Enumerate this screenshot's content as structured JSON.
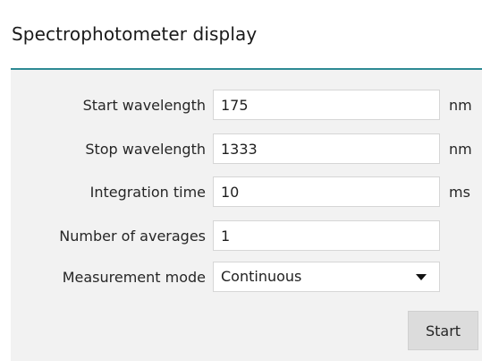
{
  "window": {
    "title": "Spectrophotometer display"
  },
  "form": {
    "rows": [
      {
        "label": "Start wavelength",
        "value": "175",
        "unit": "nm"
      },
      {
        "label": "Stop wavelength",
        "value": "1333",
        "unit": "nm"
      },
      {
        "label": "Integration time",
        "value": "10",
        "unit": "ms"
      },
      {
        "label": "Number of averages",
        "value": "1",
        "unit": ""
      }
    ],
    "mode": {
      "label": "Measurement mode",
      "selected": "Continuous",
      "icon": "chevron-down-icon"
    }
  },
  "actions": {
    "start_label": "Start"
  },
  "colors": {
    "accent_rule": "#2e8a94",
    "panel_bg": "#f2f2f2",
    "button_bg": "#dcdcdc"
  }
}
